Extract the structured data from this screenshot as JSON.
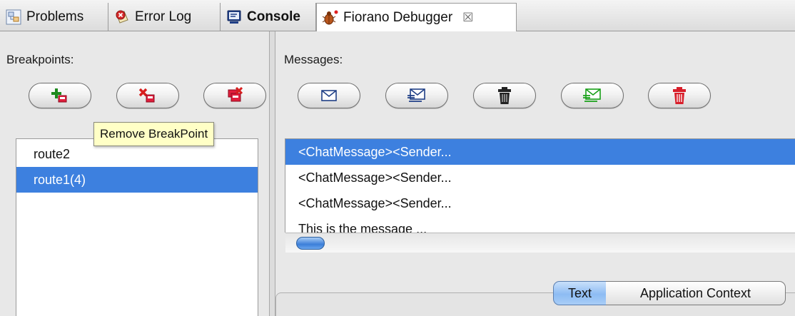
{
  "tabs": [
    {
      "label": "Problems",
      "icon": "problems-icon",
      "active": false,
      "bold": false
    },
    {
      "label": "Error Log",
      "icon": "error-log-icon",
      "active": false,
      "bold": false
    },
    {
      "label": "Console",
      "icon": "console-icon",
      "active": false,
      "bold": true
    },
    {
      "label": "Fiorano Debugger",
      "icon": "debugger-bug-icon",
      "active": true,
      "bold": false
    }
  ],
  "tab_close_glyph": "☒",
  "breakpoints": {
    "label": "Breakpoints:",
    "buttons": [
      {
        "name": "add-breakpoint",
        "icon": "add-breakpoint-icon"
      },
      {
        "name": "remove-breakpoint",
        "icon": "remove-breakpoint-icon"
      },
      {
        "name": "remove-all-breakpoints",
        "icon": "remove-all-breakpoints-icon"
      }
    ],
    "items": [
      {
        "label": "route2",
        "selected": false
      },
      {
        "label": "route1(4)",
        "selected": true
      }
    ],
    "tooltip": "Remove BreakPoint"
  },
  "messages": {
    "label": "Messages:",
    "buttons": [
      {
        "name": "view-message",
        "icon": "envelope-icon"
      },
      {
        "name": "edit-message",
        "icon": "edit-envelope-icon"
      },
      {
        "name": "delete-message",
        "icon": "trash-icon"
      },
      {
        "name": "send-message",
        "icon": "send-envelope-icon"
      },
      {
        "name": "delete-all-messages",
        "icon": "red-trash-icon"
      }
    ],
    "items": [
      {
        "label": "<ChatMessage><Sender...",
        "selected": true
      },
      {
        "label": "<ChatMessage><Sender...",
        "selected": false
      },
      {
        "label": "<ChatMessage><Sender...",
        "selected": false
      },
      {
        "label": "This is the message ...",
        "selected": false
      }
    ]
  },
  "view_tabs": [
    {
      "label": "Text",
      "selected": true
    },
    {
      "label": "Application Context",
      "selected": false
    }
  ],
  "colors": {
    "selection": "#3d80df",
    "tooltip_bg": "#ffffc6",
    "segment_selected": "#8dbcf3"
  }
}
